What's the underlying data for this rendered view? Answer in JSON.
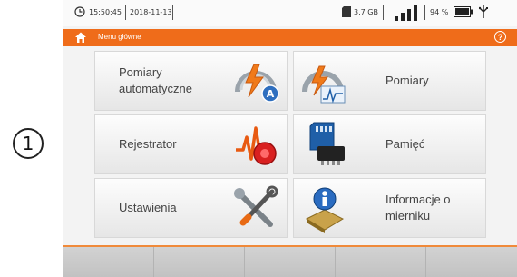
{
  "callout": {
    "number": "1"
  },
  "status": {
    "time": "15:50:45",
    "date": "2018-11-13",
    "memory": "3.7 GB",
    "battery_percent": "94 %",
    "signal_level": 1.0,
    "battery_level": 0.94,
    "icons": [
      "clock-icon",
      "sd-card-icon",
      "signal-bars-icon",
      "battery-icon",
      "usb-icon"
    ]
  },
  "header": {
    "title": "Menu główne",
    "home_icon": "home-icon",
    "help_symbol": "?"
  },
  "menu": {
    "items": [
      {
        "label": "Pomiary\nautomatyczne",
        "icon": "auto-measurement-icon"
      },
      {
        "label": "Pomiary",
        "icon": "measurement-icon"
      },
      {
        "label": "Rejestrator",
        "icon": "recorder-icon"
      },
      {
        "label": "Pamięć",
        "icon": "memory-card-icon"
      },
      {
        "label": "Ustawienia",
        "icon": "settings-tools-icon"
      },
      {
        "label": "Informacje o\nmierniku",
        "icon": "meter-info-icon"
      }
    ]
  },
  "colors": {
    "accent": "#ef6c1a",
    "tile_text": "#444444",
    "background": "#f3f3f3"
  }
}
